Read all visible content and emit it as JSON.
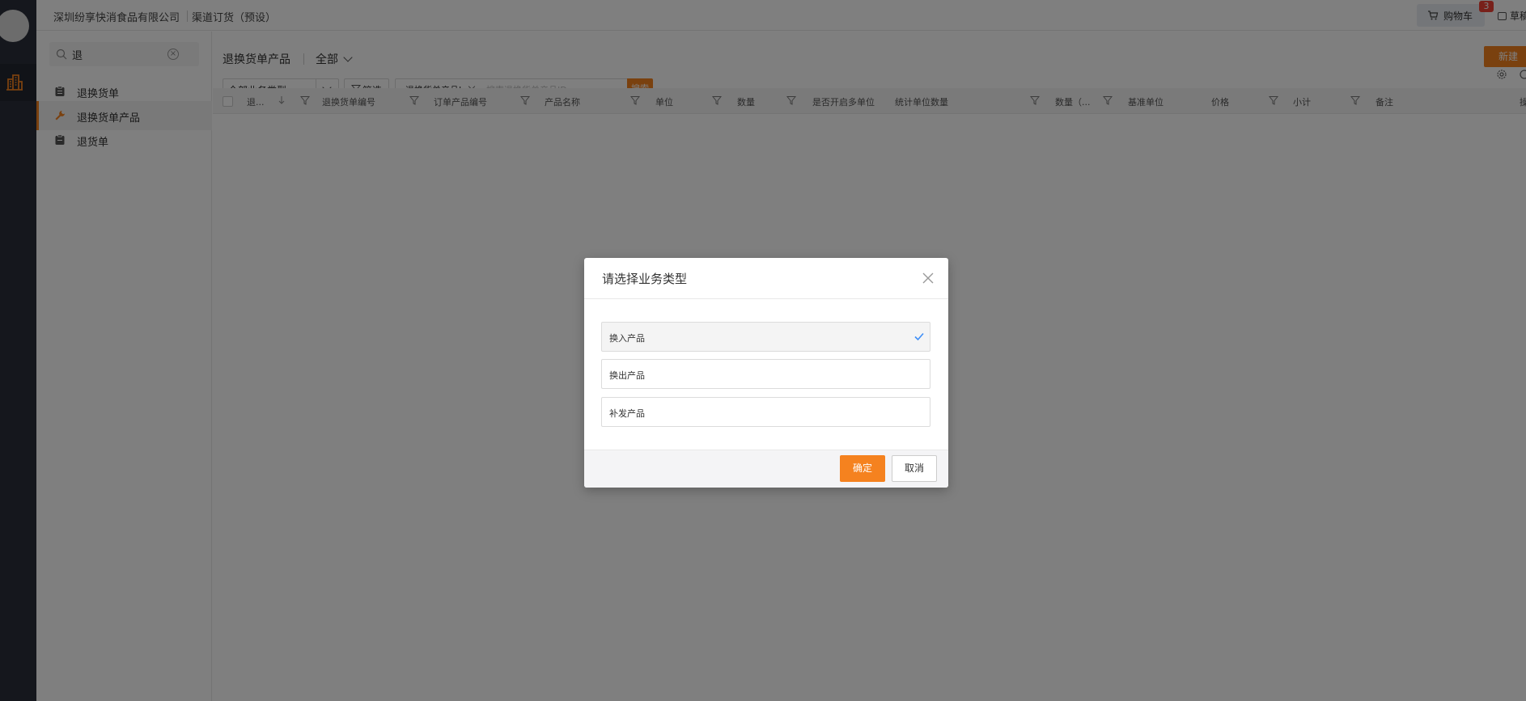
{
  "topbar": {
    "company": "深圳纷享快消食品有限公司",
    "channel": "渠道订货（预设）",
    "cart_label": "购物车",
    "cart_badge": "3",
    "draft_label": "草稿箱"
  },
  "sidebar": {
    "search_value": "退",
    "items": [
      {
        "label": "退换货单"
      },
      {
        "label": "退换货单产品"
      },
      {
        "label": "退货单"
      }
    ]
  },
  "main": {
    "title": "退换货单产品",
    "scope": "全部",
    "new_label": "新建",
    "biz_type_select": "全部业务类型",
    "filter_label": "筛选",
    "search_field": "退换货单产品I",
    "search_placeholder": "搜索退换货单产品ID",
    "search_button": "搜索",
    "columns": [
      "退...",
      "退换货单编号",
      "订单产品编号",
      "产品名称",
      "单位",
      "数量",
      "是否开启多单位",
      "统计单位数量",
      "数量（...",
      "基准单位",
      "价格",
      "小计",
      "备注",
      "操"
    ]
  },
  "modal": {
    "title": "请选择业务类型",
    "options": [
      {
        "label": "换入产品",
        "selected": true
      },
      {
        "label": "换出产品",
        "selected": false
      },
      {
        "label": "补发产品",
        "selected": false
      }
    ],
    "ok_label": "确定",
    "cancel_label": "取消"
  },
  "colors": {
    "accent": "#f5821f",
    "rail": "#2b2f3a",
    "check": "#3e8ef7",
    "badge": "#f04134"
  }
}
